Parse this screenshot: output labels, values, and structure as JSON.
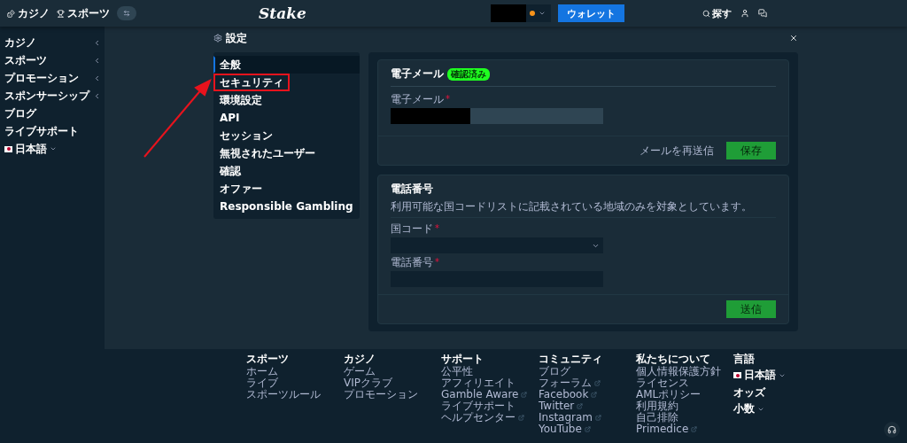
{
  "topbar": {
    "tabs": [
      {
        "label": "カジノ",
        "kind": "casino"
      },
      {
        "label": "スポーツ",
        "kind": "sports"
      }
    ],
    "logo": "Stake",
    "wallet_button": "ウォレット",
    "search": "探す"
  },
  "sidebar": {
    "items": [
      {
        "label": "カジノ",
        "expandable": true
      },
      {
        "label": "スポーツ",
        "expandable": true
      },
      {
        "label": "プロモーション",
        "expandable": true
      },
      {
        "label": "スポンサーシップ",
        "expandable": true
      },
      {
        "label": "ブログ",
        "expandable": false
      },
      {
        "label": "ライブサポート",
        "expandable": false
      }
    ],
    "language": "日本語"
  },
  "modal": {
    "title": "設定",
    "nav": [
      {
        "label": "全般",
        "selected": true,
        "highlighted": false
      },
      {
        "label": "セキュリティ",
        "selected": false,
        "highlighted": true
      },
      {
        "label": "環境設定",
        "selected": false,
        "highlighted": false
      },
      {
        "label": "API",
        "selected": false,
        "highlighted": false
      },
      {
        "label": "セッション",
        "selected": false,
        "highlighted": false
      },
      {
        "label": "無視されたユーザー",
        "selected": false,
        "highlighted": false
      },
      {
        "label": "確認",
        "selected": false,
        "highlighted": false
      },
      {
        "label": "オファー",
        "selected": false,
        "highlighted": false
      },
      {
        "label": "Responsible Gambling",
        "selected": false,
        "highlighted": false
      }
    ],
    "email_card": {
      "title": "電子メール",
      "badge": "確認済み",
      "field": {
        "label": "電子メール",
        "required_mark": "*"
      },
      "resend_link": "メールを再送信",
      "save_button": "保存"
    },
    "phone_card": {
      "title": "電話番号",
      "description": "利用可能な国コードリストに記載されている地域のみを対象としています。",
      "country_field": {
        "label": "国コード",
        "required_mark": "*"
      },
      "phone_field": {
        "label": "電話番号",
        "required_mark": "*"
      },
      "submit_button": "送信"
    }
  },
  "footer": {
    "columns": [
      {
        "title": "スポーツ",
        "links": [
          {
            "label": "ホーム",
            "external": false
          },
          {
            "label": "ライブ",
            "external": false
          },
          {
            "label": "スポーツルール",
            "external": false
          }
        ]
      },
      {
        "title": "カジノ",
        "links": [
          {
            "label": "ゲーム",
            "external": false
          },
          {
            "label": "VIPクラブ",
            "external": false
          },
          {
            "label": "プロモーション",
            "external": false
          }
        ]
      },
      {
        "title": "サポート",
        "links": [
          {
            "label": "公平性",
            "external": false
          },
          {
            "label": "アフィリエイト",
            "external": false
          },
          {
            "label": "Gamble Aware",
            "external": true
          },
          {
            "label": "ライブサポート",
            "external": false
          },
          {
            "label": "ヘルプセンター",
            "external": true
          }
        ]
      },
      {
        "title": "コミュニティ",
        "links": [
          {
            "label": "ブログ",
            "external": false
          },
          {
            "label": "フォーラム",
            "external": true
          },
          {
            "label": "Facebook",
            "external": true
          },
          {
            "label": "Twitter",
            "external": true
          },
          {
            "label": "Instagram",
            "external": true
          },
          {
            "label": "YouTube",
            "external": true
          }
        ]
      },
      {
        "title": "私たちについて",
        "links": [
          {
            "label": "個人情報保護方針",
            "external": false
          },
          {
            "label": "ライセンス",
            "external": false
          },
          {
            "label": "AMLポリシー",
            "external": false
          },
          {
            "label": "利用規約",
            "external": false
          },
          {
            "label": "自己排除",
            "external": false
          },
          {
            "label": "Primedice",
            "external": true
          }
        ]
      }
    ],
    "language_title": "言語",
    "language": "日本語",
    "odds_title": "オッズ",
    "odds": "小数"
  }
}
